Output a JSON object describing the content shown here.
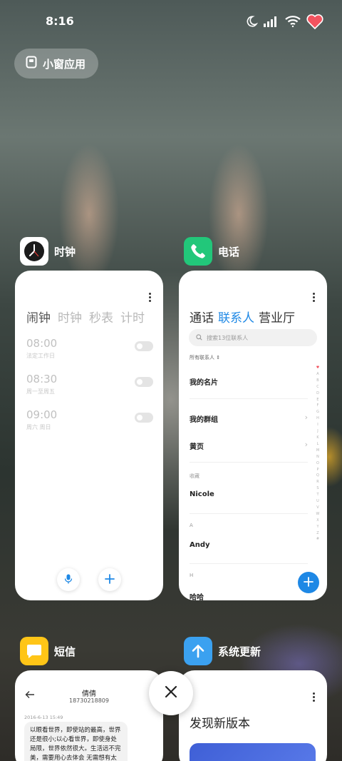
{
  "status_bar": {
    "time": "8:16",
    "icons": [
      "moon-icon",
      "signal-icon",
      "wifi-icon",
      "heart-icon"
    ],
    "heart_color": "#f2535f"
  },
  "floating_window_button": {
    "label": "小窗应用"
  },
  "apps": {
    "clock": {
      "name": "时钟",
      "tabs": [
        "闹钟",
        "时钟",
        "秒表",
        "计时"
      ],
      "alarms": [
        {
          "time": "08:00",
          "desc": "法定工作日"
        },
        {
          "time": "08:30",
          "desc": "周一至周五"
        },
        {
          "time": "09:00",
          "desc": "周六 周日"
        }
      ]
    },
    "phone": {
      "name": "电话",
      "tabs": [
        "通话",
        "联系人",
        "营业厅"
      ],
      "active_tab": "联系人",
      "search_placeholder": "搜索13位联系人",
      "filter": "所有联系人",
      "rows": {
        "my_card": "我的名片",
        "my_groups": "我的群组",
        "yellow_pages": "黄页",
        "favorites_header": "收藏",
        "favorite": "Nicole",
        "section_a": "A",
        "contact_a": "Andy",
        "section_h": "H",
        "contact_h": "哈哈"
      },
      "alphabet": [
        "♥",
        "A",
        "B",
        "C",
        "D",
        "E",
        "F",
        "G",
        "H",
        "I",
        "J",
        "K",
        "L",
        "M",
        "N",
        "O",
        "P",
        "Q",
        "R",
        "S",
        "T",
        "U",
        "V",
        "W",
        "X",
        "Y",
        "Z",
        "#"
      ],
      "accent": "#1e88e5"
    },
    "sms": {
      "name": "短信",
      "contact_name": "倩倩",
      "contact_number": "18730218809",
      "timestamp": "2016-6-13 15:49",
      "message": "以眼看世界，即使站的最高，世界还是很小;以心看世界，即使身处局限，世界依然很大。生活远不完美，需要用心去体会 无需想有太"
    },
    "update": {
      "name": "系统更新",
      "heading": "发现新版本"
    }
  },
  "close_button": {
    "icon": "close-icon"
  }
}
